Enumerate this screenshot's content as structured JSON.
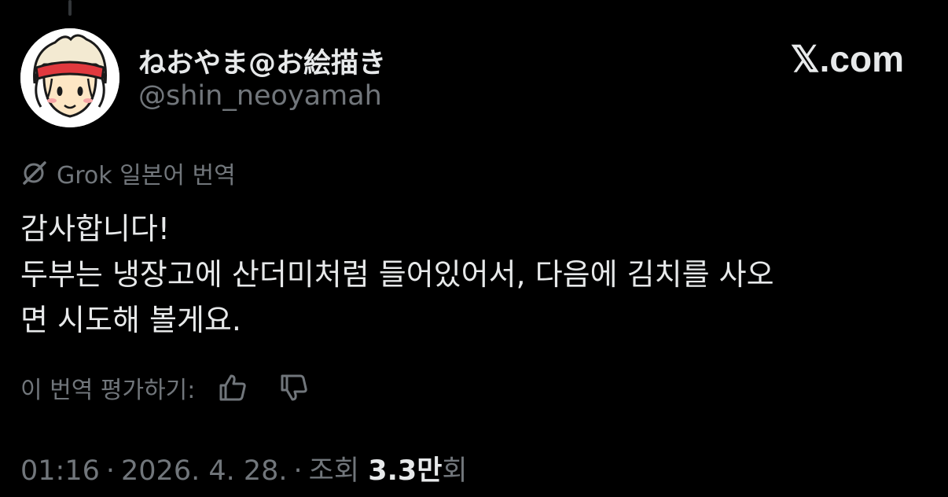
{
  "author": {
    "display_name": "ねおやま@お絵描き",
    "handle": "@shin_neoyamah"
  },
  "brand": {
    "label": "𝕏.com"
  },
  "translation": {
    "label": "Grok 일본어 번역",
    "icon": "grok-icon"
  },
  "tweet": {
    "lines": [
      "감사합니다!",
      "두부는 냉장고에 산더미처럼 들어있어서, 다음에 김치를 사오",
      "면 시도해 볼게요."
    ]
  },
  "rating": {
    "label": "이 번역 평가하기:",
    "like_icon": "thumbs-up-icon",
    "dislike_icon": "thumbs-down-icon"
  },
  "meta": {
    "time": "01:16",
    "date": "2026. 4. 28.",
    "views_label": "조회",
    "views_count": "3.3만",
    "views_suffix": "회",
    "separator": "·"
  },
  "colors": {
    "background": "#000000",
    "primary_text": "#e7e9ea",
    "secondary_text": "#71767b"
  }
}
